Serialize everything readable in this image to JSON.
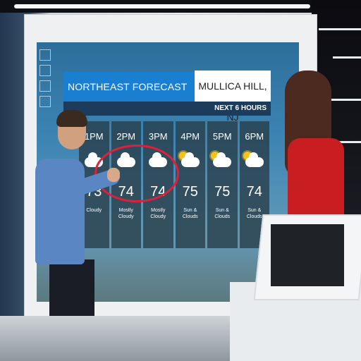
{
  "forecast_board": {
    "title": "NORTHEAST FORECAST",
    "location": "MULLICA HILL, NJ",
    "subtitle": "NEXT 6 HOURS",
    "columns": [
      {
        "time": "1PM",
        "icon": "cloud-icon",
        "temp": "73",
        "condition": "Cloudy"
      },
      {
        "time": "2PM",
        "icon": "cloud-icon",
        "temp": "74",
        "condition": "Mostly Cloudy"
      },
      {
        "time": "3PM",
        "icon": "cloud-icon",
        "temp": "74",
        "condition": "Mostly Cloudy"
      },
      {
        "time": "4PM",
        "icon": "sun-cloud-icon",
        "temp": "75",
        "condition": "Sun & Clouds"
      },
      {
        "time": "5PM",
        "icon": "sun-cloud-icon",
        "temp": "75",
        "condition": "Sun & Clouds"
      },
      {
        "time": "6PM",
        "icon": "sun-cloud-icon",
        "temp": "74",
        "condition": "Sun & Clouds"
      }
    ]
  },
  "colors": {
    "title_bar": "#1a7fd1",
    "highlight_circle": "#e0203a",
    "man_shirt": "#5a86c4",
    "woman_dress": "#c81e22"
  }
}
